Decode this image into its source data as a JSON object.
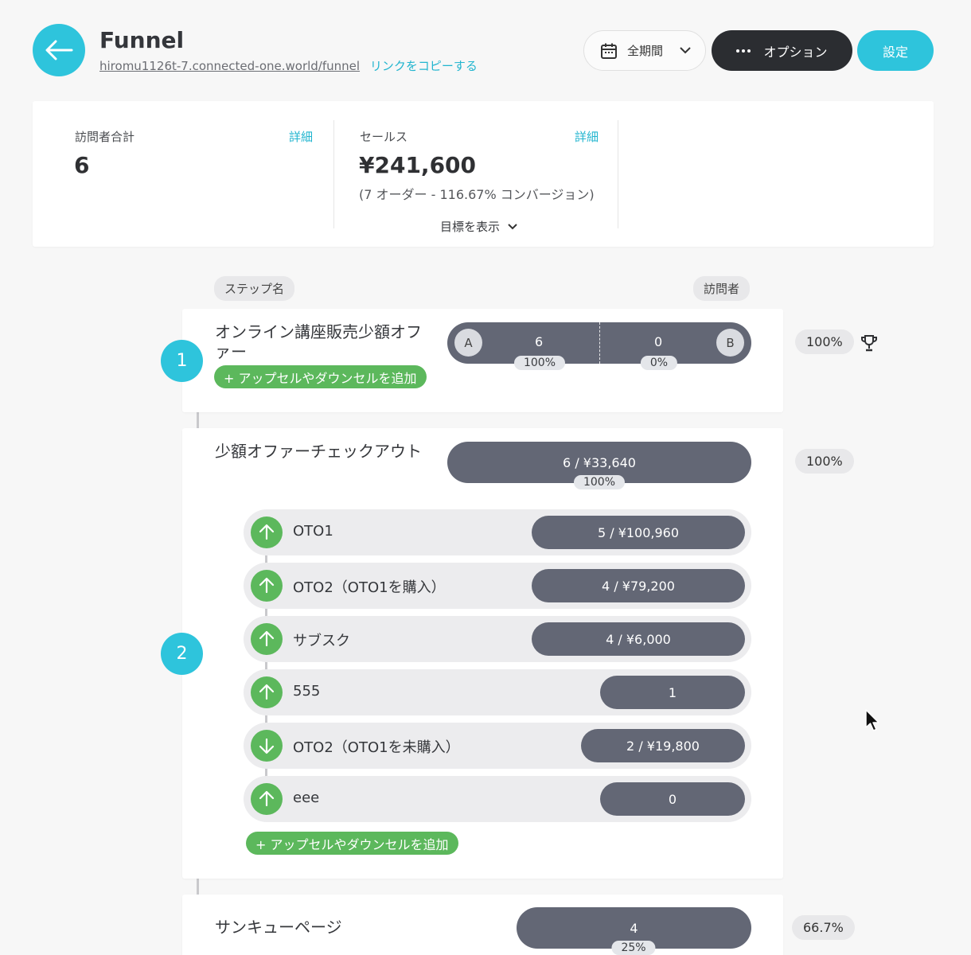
{
  "header": {
    "title": "Funnel",
    "url": "hiromu1126t-7.connected-one.world/funnel",
    "copy_link": "リンクをコピーする",
    "period": "全期間",
    "options": "オプション",
    "settings": "設定"
  },
  "stats": {
    "visitors": {
      "label": "訪問者合計",
      "detail": "詳細",
      "value": "6"
    },
    "sales": {
      "label": "セールス",
      "detail": "詳細",
      "value": "¥241,600",
      "sub": "(7 オーダー - 116.67% コンバージョン)"
    },
    "goal_toggle": "目標を表示"
  },
  "columns": {
    "step_name": "ステップ名",
    "visitors": "訪問者"
  },
  "steps": [
    {
      "number": "1",
      "name": "オンライン講座販売少額オファー",
      "add_upsell": "+ アップセルやダウンセルを追加",
      "ab": {
        "a_label": "A",
        "a_value": "6",
        "a_pct": "100%",
        "b_label": "B",
        "b_value": "0",
        "b_pct": "0%"
      },
      "rate": "100%"
    },
    {
      "number": "2",
      "name": "少額オファーチェックアウト",
      "bar": "6 / ¥33,640",
      "bar_pct": "100%",
      "rate": "100%",
      "upsells": [
        {
          "direction": "up",
          "label": "OTO1",
          "value": "5 / ¥100,960"
        },
        {
          "direction": "up",
          "label": "OTO2（OTO1を購入）",
          "value": "4 / ¥79,200"
        },
        {
          "direction": "up",
          "label": "サブスク",
          "value": "4 / ¥6,000"
        },
        {
          "direction": "up",
          "label": "555",
          "value": "1"
        },
        {
          "direction": "down",
          "label": "OTO2（OTO1を未購入）",
          "value": "2 / ¥19,800"
        },
        {
          "direction": "up",
          "label": "eee",
          "value": "0"
        }
      ],
      "add_upsell": "+ アップセルやダウンセルを追加"
    },
    {
      "name": "サンキューページ",
      "bar": "4",
      "bar_pct": "25%",
      "rate": "66.7%"
    }
  ],
  "colors": {
    "accent": "#2ec4dc",
    "dark_button": "#2b2d31",
    "bar": "#636775",
    "green": "#5cb85c",
    "link": "#22b5cf"
  },
  "icons": [
    "arrow-left-icon",
    "calendar-icon",
    "chevron-down-icon",
    "more-dots-icon",
    "trophy-icon",
    "arrow-up-icon",
    "arrow-down-icon",
    "mouse-cursor-icon"
  ]
}
